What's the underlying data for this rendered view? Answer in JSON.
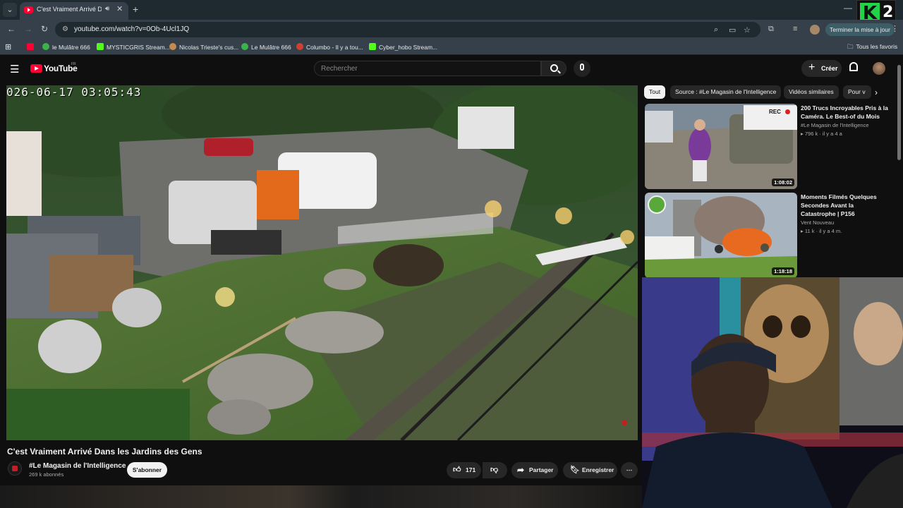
{
  "browser": {
    "tab_menu_icon": "chevron-down-icon",
    "active_tab_title": "C'est Vraiment Arrivé Dans les",
    "new_tab_icon": "plus-icon",
    "url": "youtube.com/watch?v=0Ob-4Ucl1JQ",
    "update_button": "Terminer la mise à jour",
    "all_bookmarks": "Tous les favoris",
    "bookmarks": [
      {
        "label": "le Mulâtre 666",
        "color": "#3bb34a"
      },
      {
        "label": "MYSTICGRIS Stream...",
        "color": "#53fc18"
      },
      {
        "label": "Nicolas Trieste's cus...",
        "color": "#c48a50"
      },
      {
        "label": "Le Mulâtre 666",
        "color": "#3bb34a"
      },
      {
        "label": "Columbo - Il y a tou...",
        "color": "#d04030"
      },
      {
        "label": "Cyber_hobo Stream...",
        "color": "#53fc18"
      }
    ]
  },
  "overlay_logo": {
    "letter": "K",
    "number": "2"
  },
  "youtube": {
    "logo_text": "YouTube",
    "country": "FR",
    "search_placeholder": "Rechercher",
    "create_label": "Créer"
  },
  "video": {
    "timestamp_overlay": "026-06-17  03:05:43",
    "title": "C'est Vraiment Arrivé Dans les Jardins des Gens",
    "channel": "#Le Magasin de l'Intelligence",
    "subscribers": "269 k abonnés",
    "subscribe_label": "S'abonner",
    "likes": "171",
    "share_label": "Partager",
    "save_label": "Enregistrer"
  },
  "sidebar": {
    "chips": [
      "Tout",
      "Source : #Le Magasin de l'Intelligence",
      "Vidéos similaires",
      "Pour v"
    ],
    "recommendations": [
      {
        "title": "200 Trucs Incroyables Pris à la Caméra. Le Best-of du Mois",
        "channel": "#Le Magasin de l'Intelligence",
        "meta": "796 k · il y a 4 a",
        "duration": "1:08:02",
        "badge": "REC"
      },
      {
        "title": "Moments Filmés Quelques Secondes Avant la Catastrophe | P156",
        "channel": "Vent Nouveau",
        "meta": "11 k · il y a 4 m.",
        "duration": "1:18:18"
      }
    ]
  }
}
